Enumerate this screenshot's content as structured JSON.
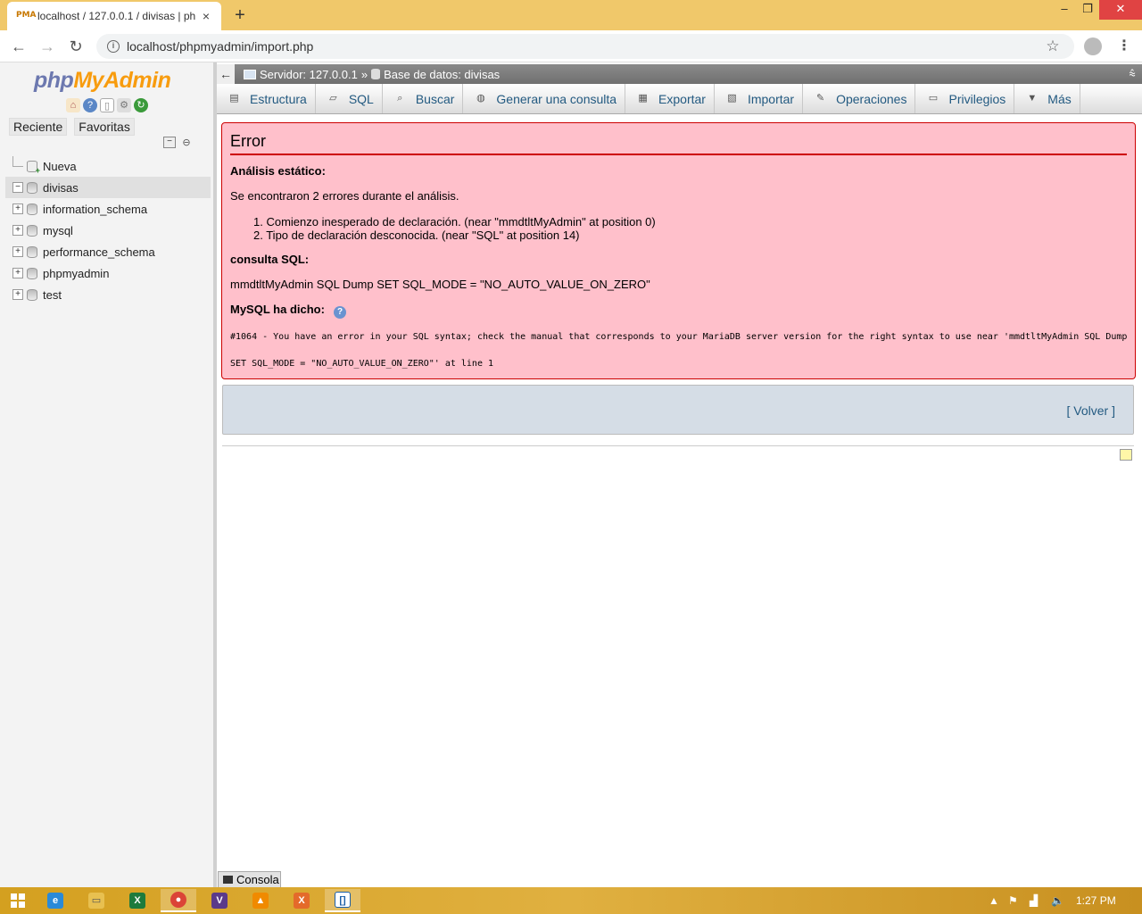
{
  "browser": {
    "tab_title": "localhost / 127.0.0.1 / divisas | ph",
    "favicon_text": "PMA",
    "new_tab": "+",
    "close_tab": "×",
    "url": "localhost/phpmyadmin/import.php",
    "window_min": "–",
    "window_max": "❐",
    "window_close": "✕"
  },
  "sidebar": {
    "logo_php": "php",
    "logo_my": "My",
    "logo_admin": "Admin",
    "tabs": [
      "Reciente",
      "Favoritas"
    ],
    "tree": [
      {
        "label": "Nueva",
        "kind": "new"
      },
      {
        "label": "divisas",
        "kind": "db",
        "expander": "−",
        "active": true
      },
      {
        "label": "information_schema",
        "kind": "db",
        "expander": "+"
      },
      {
        "label": "mysql",
        "kind": "db",
        "expander": "+"
      },
      {
        "label": "performance_schema",
        "kind": "db",
        "expander": "+"
      },
      {
        "label": "phpmyadmin",
        "kind": "db",
        "expander": "+"
      },
      {
        "label": "test",
        "kind": "db",
        "expander": "+"
      }
    ]
  },
  "breadcrumb": {
    "server": "Servidor: 127.0.0.1",
    "separator": "»",
    "database": "Base de datos: divisas"
  },
  "menu": [
    {
      "label": "Estructura",
      "icon": "structure-icon"
    },
    {
      "label": "SQL",
      "icon": "sql-icon"
    },
    {
      "label": "Buscar",
      "icon": "search-icon"
    },
    {
      "label": "Generar una consulta",
      "icon": "query-icon"
    },
    {
      "label": "Exportar",
      "icon": "export-icon"
    },
    {
      "label": "Importar",
      "icon": "import-icon"
    },
    {
      "label": "Operaciones",
      "icon": "wrench-icon"
    },
    {
      "label": "Privilegios",
      "icon": "privileges-icon"
    },
    {
      "label": "Más",
      "icon": "caret-down-icon"
    }
  ],
  "error": {
    "title": "Error",
    "static_heading": "Análisis estático:",
    "found_text": "Se encontraron 2 errores durante el análisis.",
    "items": [
      "1. Comienzo inesperado de declaración. (near \"mmdtltMyAdmin\" at position 0)",
      "2. Tipo de declaración desconocida. (near \"SQL\" at position 14)"
    ],
    "sql_heading": "consulta SQL:",
    "sql_text": "mmdtltMyAdmin SQL Dump SET SQL_MODE = \"NO_AUTO_VALUE_ON_ZERO\"",
    "mysql_heading": "MySQL ha dicho:",
    "message_line1": "#1064 - You have an error in your SQL syntax; check the manual that corresponds to your MariaDB server version for the right syntax to use near 'mmdtltMyAdmin SQL Dump",
    "message_line2": "SET SQL_MODE = \"NO_AUTO_VALUE_ON_ZERO\"' at line 1"
  },
  "back_link": {
    "open": "[",
    "label": "Volver",
    "close": "]"
  },
  "console_label": "Consola",
  "taskbar": {
    "clock": "1:27 PM"
  }
}
